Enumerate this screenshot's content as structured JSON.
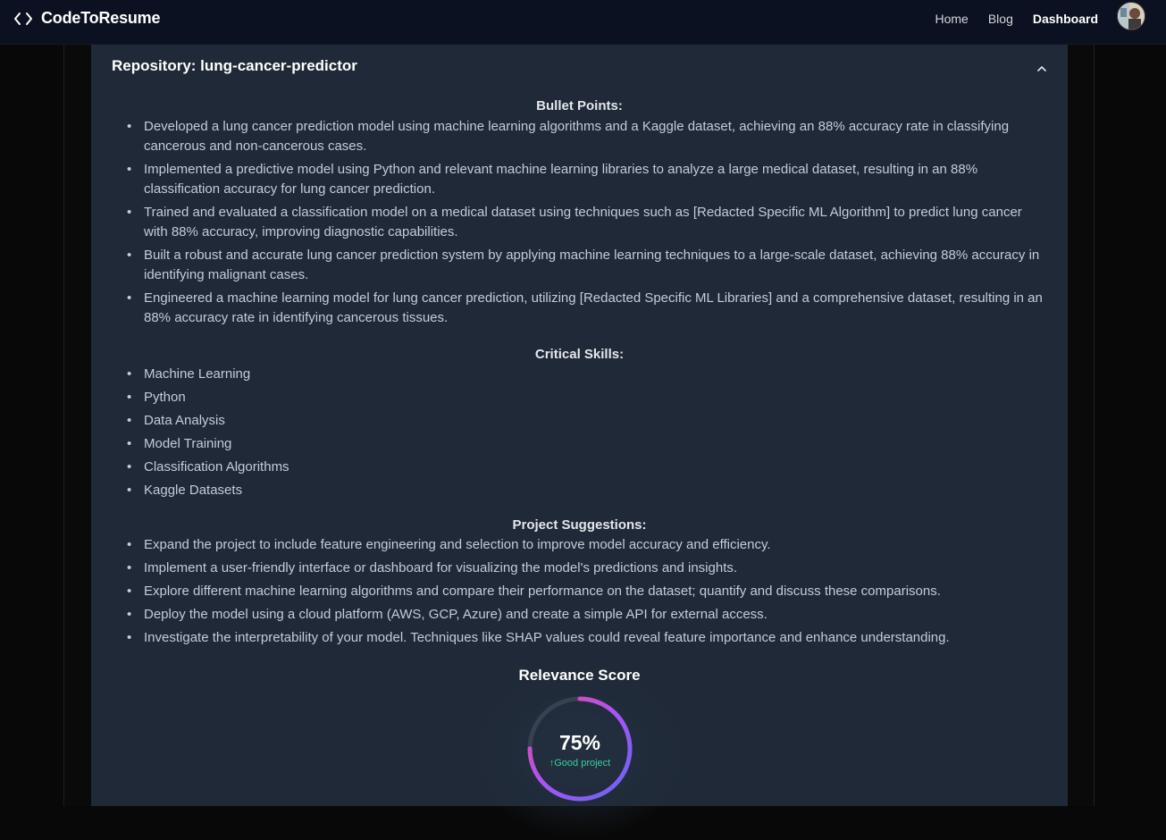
{
  "nav": {
    "brand": "CodeToResume",
    "links": [
      "Home",
      "Blog",
      "Dashboard"
    ]
  },
  "repository": {
    "title": "Repository: lung-cancer-predictor"
  },
  "bullet_points": {
    "title": "Bullet Points:",
    "items": [
      "Developed a lung cancer prediction model using machine learning algorithms and a Kaggle dataset, achieving an 88% accuracy rate in classifying cancerous and non-cancerous cases.",
      "Implemented a predictive model using Python and relevant machine learning libraries to analyze a large medical dataset, resulting in an 88% classification accuracy for lung cancer prediction.",
      "Trained and evaluated a classification model on a medical dataset using techniques such as [Redacted Specific ML Algorithm] to predict lung cancer with 88% accuracy, improving diagnostic capabilities.",
      "Built a robust and accurate lung cancer prediction system by applying machine learning techniques to a large-scale dataset, achieving 88% accuracy in identifying malignant cases.",
      "Engineered a machine learning model for lung cancer prediction, utilizing [Redacted Specific ML Libraries] and a comprehensive dataset, resulting in an 88% accuracy rate in identifying cancerous tissues."
    ]
  },
  "critical_skills": {
    "title": "Critical Skills:",
    "items": [
      "Machine Learning",
      "Python",
      "Data Analysis",
      "Model Training",
      "Classification Algorithms",
      "Kaggle Datasets"
    ]
  },
  "project_suggestions": {
    "title": "Project Suggestions:",
    "items": [
      "Expand the project to include feature engineering and selection to improve model accuracy and efficiency.",
      "Implement a user-friendly interface or dashboard for visualizing the model's predictions and insights.",
      "Explore different machine learning algorithms and compare their performance on the dataset; quantify and discuss these comparisons.",
      "Deploy the model using a cloud platform (AWS, GCP, Azure) and create a simple API for external access.",
      "Investigate the interpretability of your model. Techniques like SHAP values could reveal feature importance and enhance understanding."
    ]
  },
  "relevance": {
    "title": "Relevance Score",
    "value_text": "75%",
    "fraction": 0.75,
    "note": "Good project",
    "colors": {
      "track": "#374151",
      "gradient_start": "#ec4899",
      "gradient_mid": "#a855f7",
      "gradient_end": "#6366f1",
      "note": "#34d399"
    }
  },
  "icons": {
    "brand": "code-brackets-icon",
    "chevron": "chevron-up-icon",
    "note": "arrow-up-icon"
  }
}
